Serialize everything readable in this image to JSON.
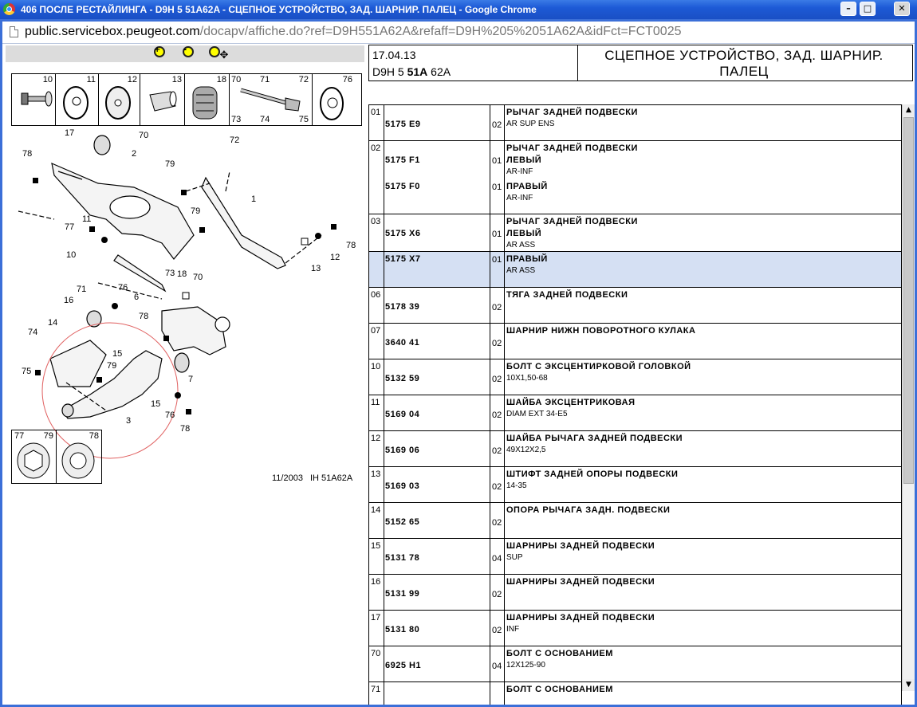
{
  "window": {
    "title": "406 ПОСЛЕ РЕСТАЙЛИНГА - D9H 5 51A62A - СЦЕПНОЕ УСТРОЙСТВО, ЗАД. ШАРНИР. ПАЛЕЦ - Google Chrome",
    "minimize_glyph": "–",
    "maximize_glyph": "□",
    "close_glyph": "✕"
  },
  "address": {
    "host": "public.servicebox.peugeot.com",
    "path": "/docapv/affiche.do?ref=D9H551A62A&refaff=D9H%205%2051A62A&idFct=FCT0025"
  },
  "toolbar": {
    "zoom_in_icon": "zoom-in-icon",
    "zoom_out_icon": "zoom-out-icon",
    "pan_icon": "zoom-pan-icon"
  },
  "diagram": {
    "top_parts_numbers": [
      "10",
      "11",
      "12",
      "13",
      "18",
      "70",
      "71",
      "72",
      "73",
      "74",
      "75",
      "76"
    ],
    "callouts": [
      "17",
      "70",
      "72",
      "78",
      "2",
      "79",
      "1",
      "11",
      "77",
      "79",
      "78",
      "10",
      "12",
      "13",
      "73",
      "76",
      "71",
      "18",
      "70",
      "16",
      "6",
      "78",
      "14",
      "15",
      "74",
      "79",
      "75",
      "7",
      "15",
      "76",
      "3",
      "78"
    ],
    "bottom_parts_numbers": [
      "77",
      "79",
      "78"
    ],
    "date_label": "11/2003",
    "ref_label": "IH 51A62A"
  },
  "header": {
    "date": "17.04.13",
    "code_prefix": "D9H 5 ",
    "code_bold": "51A",
    "code_suffix": " 62A",
    "title": "СЦЕПНОЕ УСТРОЙСТВО, ЗАД. ШАРНИР. ПАЛЕЦ"
  },
  "rows": [
    {
      "pos": "01",
      "lines": [
        {
          "pn": "5175 E9",
          "qty": "02",
          "name": "РЫЧАГ ЗАДНЕЙ ПОДВЕСКИ",
          "sub": "AR SUP ENS"
        }
      ]
    },
    {
      "pos": "02",
      "lines": [
        {
          "pn": "5175 F1",
          "qty": "01",
          "name": "РЫЧАГ ЗАДНЕЙ ПОДВЕСКИ",
          "name2": "ЛЕВЫЙ",
          "sub": "AR-INF"
        },
        {
          "pn": "5175 F0",
          "qty": "01",
          "name2": "ПРАВЫЙ",
          "sub": "AR-INF"
        }
      ]
    },
    {
      "pos": "03",
      "lines": [
        {
          "pn": "5175 X6",
          "qty": "01",
          "name": "РЫЧАГ ЗАДНЕЙ ПОДВЕСКИ",
          "name2": "ЛЕВЫЙ",
          "sub": "AR ASS"
        }
      ]
    },
    {
      "pos": "",
      "lines": [
        {
          "pn": "5175 X7",
          "qty": "01",
          "name2": "ПРАВЫЙ",
          "sub": "AR ASS"
        }
      ]
    },
    {
      "pos": "06",
      "lines": [
        {
          "pn": "5178 39",
          "qty": "02",
          "name": "ТЯГА ЗАДНЕЙ ПОДВЕСКИ",
          "sub": ""
        }
      ]
    },
    {
      "pos": "07",
      "lines": [
        {
          "pn": "3640 41",
          "qty": "02",
          "name": "ШАРНИР НИЖН ПОВОРОТНОГО КУЛАКА",
          "sub": ""
        }
      ]
    },
    {
      "pos": "10",
      "lines": [
        {
          "pn": "5132 59",
          "qty": "02",
          "name": "БОЛТ С ЭКСЦЕНТИРКОВОЙ ГОЛОВКОЙ",
          "sub": "10X1,50-68"
        }
      ]
    },
    {
      "pos": "11",
      "lines": [
        {
          "pn": "5169 04",
          "qty": "02",
          "name": "ШАЙБА ЭКСЦЕНТРИКОВАЯ",
          "sub": "DIAM EXT 34-E5"
        }
      ]
    },
    {
      "pos": "12",
      "lines": [
        {
          "pn": "5169 06",
          "qty": "02",
          "name": "ШАЙБА РЫЧАГА ЗАДНЕЙ ПОДВЕСКИ",
          "sub": "49X12X2,5"
        }
      ]
    },
    {
      "pos": "13",
      "lines": [
        {
          "pn": "5169 03",
          "qty": "02",
          "name": "ШТИФТ ЗАДНЕЙ ОПОРЫ ПОДВЕСКИ",
          "sub": "14-35"
        }
      ]
    },
    {
      "pos": "14",
      "lines": [
        {
          "pn": "5152 65",
          "qty": "02",
          "name": "ОПОРА РЫЧАГА ЗАДН. ПОДВЕСКИ",
          "sub": ""
        }
      ]
    },
    {
      "pos": "15",
      "lines": [
        {
          "pn": "5131 78",
          "qty": "04",
          "name": "ШАРНИРЫ ЗАДНЕЙ ПОДВЕСКИ",
          "sub": "SUP"
        }
      ]
    },
    {
      "pos": "16",
      "lines": [
        {
          "pn": "5131 99",
          "qty": "02",
          "name": "ШАРНИРЫ ЗАДНЕЙ ПОДВЕСКИ",
          "sub": ""
        }
      ]
    },
    {
      "pos": "17",
      "lines": [
        {
          "pn": "5131 80",
          "qty": "02",
          "name": "ШАРНИРЫ ЗАДНЕЙ ПОДВЕСКИ",
          "sub": "INF"
        }
      ]
    },
    {
      "pos": "70",
      "lines": [
        {
          "pn": "6925 H1",
          "qty": "04",
          "name": "БОЛТ С ОСНОВАНИЕМ",
          "sub": "12X125-90"
        }
      ]
    },
    {
      "pos": "71",
      "lines": [
        {
          "pn": "",
          "qty": "",
          "name": "БОЛТ С ОСНОВАНИЕМ",
          "sub": ""
        }
      ]
    }
  ],
  "colors": {
    "highlight_row": "#d5e0f3",
    "titlebar": "#1d5ad6",
    "circle_marker": "#e06060"
  },
  "scrollbar": {
    "up": "▲",
    "down": "▼"
  }
}
